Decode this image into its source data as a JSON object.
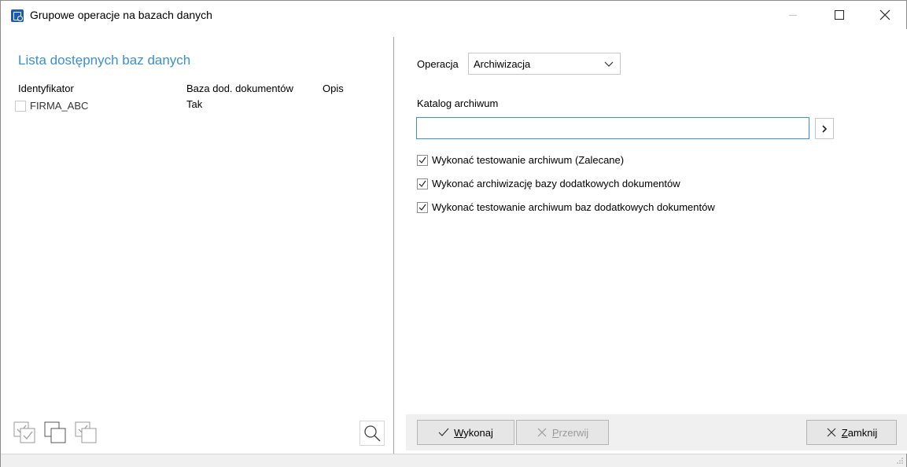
{
  "window": {
    "title": "Grupowe operacje na bazach danych",
    "icon": "database-app-icon",
    "controls": [
      "minimize-icon",
      "maximize-icon",
      "close-icon"
    ]
  },
  "left_panel": {
    "heading": "Lista dostępnych baz danych",
    "heading_color": "#3c8fd1",
    "columns": {
      "id": "Identyfikator",
      "baza": "Baza dod. dokumentów",
      "opis": "Opis"
    },
    "rows": [
      {
        "id": "FIRMA_ABC",
        "baza": "Tak",
        "opis": "",
        "checked": false
      }
    ],
    "toolbar_icons": [
      "select-all-icon",
      "deselect-all-icon",
      "invert-selection-icon"
    ],
    "search_icon": "search-icon"
  },
  "right_panel": {
    "operation_label": "Operacja",
    "operation_value": "Archiwizacja",
    "catalog_label": "Katalog archiwum",
    "catalog_value": "",
    "options": [
      {
        "label": "Wykonać testowanie archiwum (Zalecane)",
        "checked": true
      },
      {
        "label": "Wykonać archiwizację bazy dodatkowych dokumentów",
        "checked": true
      },
      {
        "label": "Wykonać testowanie archiwum baz dodatkowych dokumentów",
        "checked": true
      }
    ]
  },
  "buttons": {
    "wykonaj": {
      "label": "Wykonaj",
      "mnemonic": "W",
      "rest": "ykonaj",
      "enabled": true
    },
    "przerwij": {
      "label": "Przerwij",
      "mnemonic": "P",
      "rest": "rzerwij",
      "enabled": false
    },
    "zamknij": {
      "label": "Zamknij",
      "mnemonic": "Z",
      "rest": "amknij",
      "enabled": true
    }
  }
}
